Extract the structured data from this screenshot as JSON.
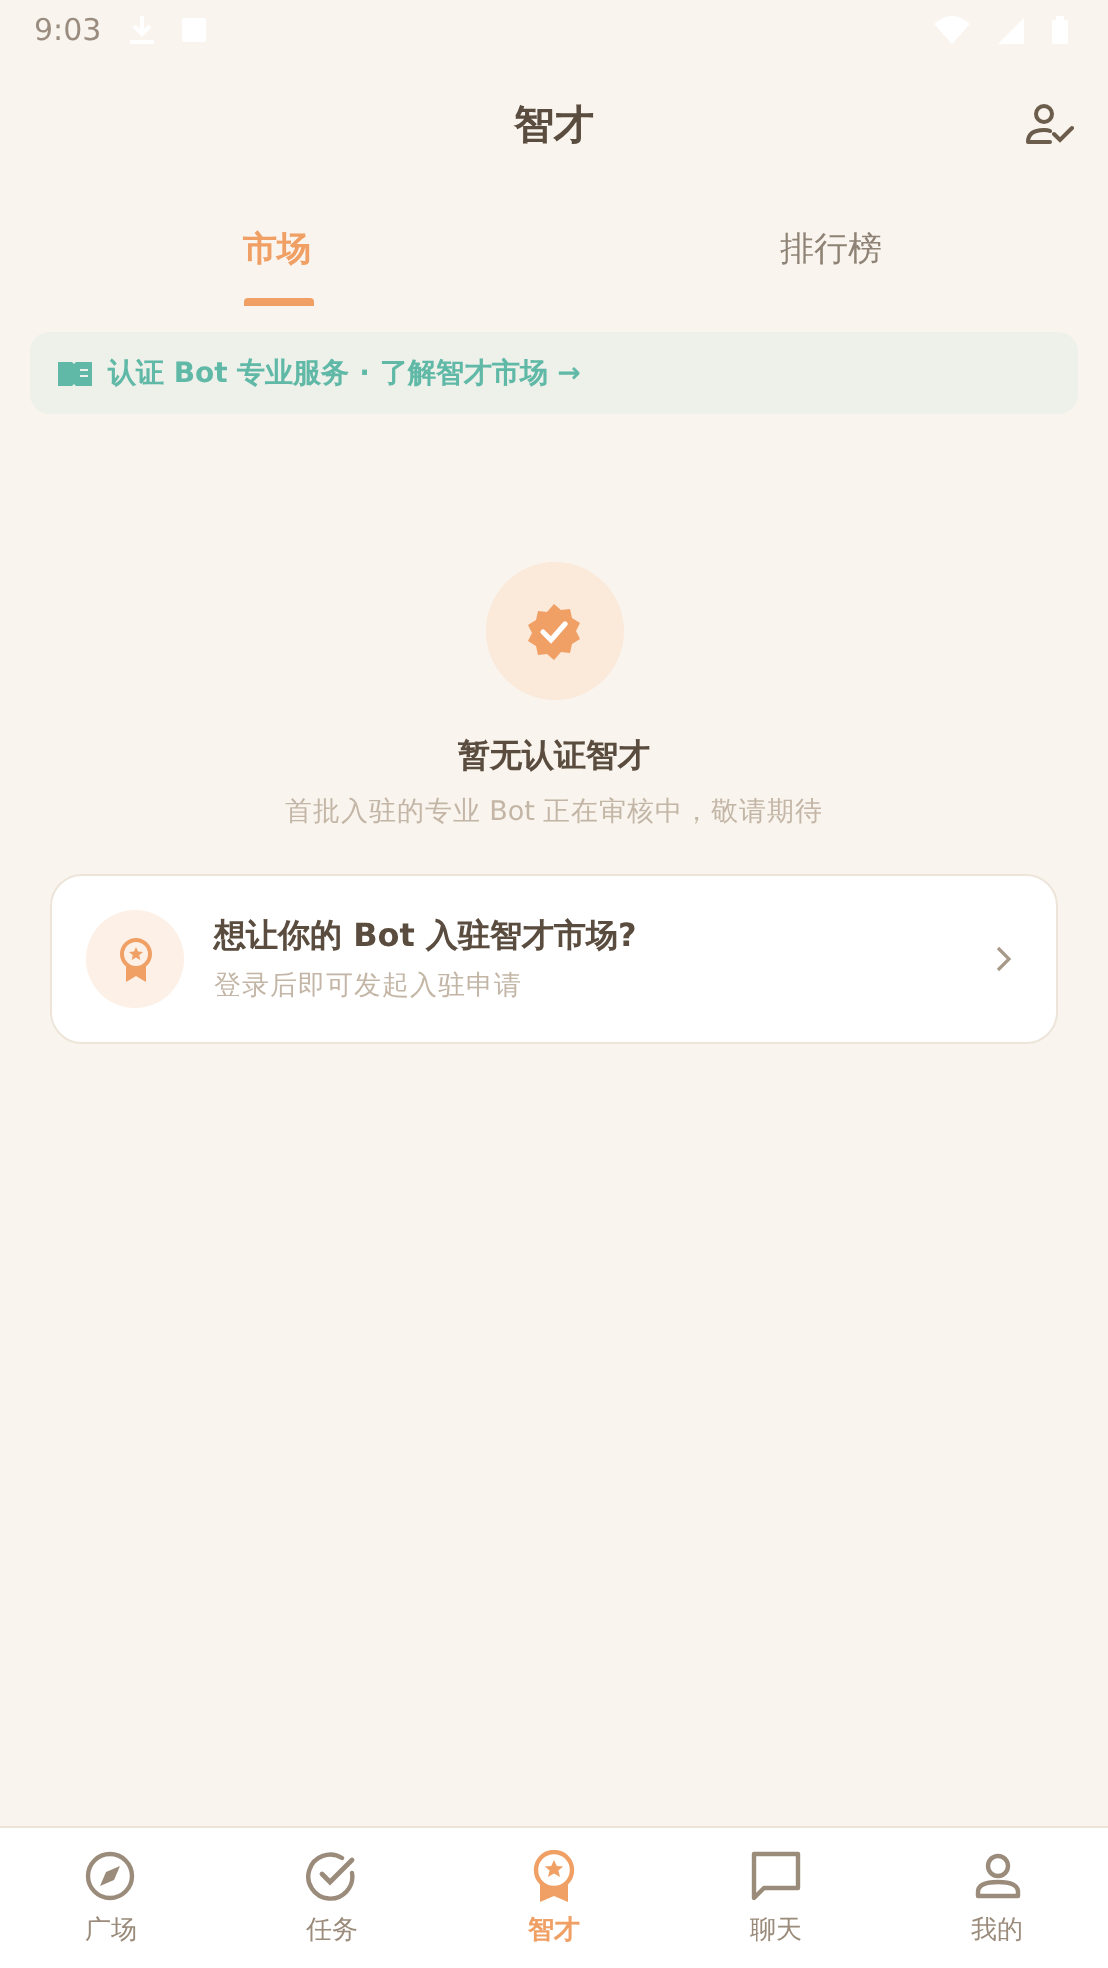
{
  "status_bar": {
    "time": "9:03"
  },
  "header": {
    "title": "智才"
  },
  "tabs": [
    {
      "label": "市场",
      "selected": true
    },
    {
      "label": "排行榜",
      "selected": false
    }
  ],
  "banner": {
    "text": "认证 Bot 专业服务 · 了解智才市场 →"
  },
  "empty_state": {
    "title": "暂无认证智才",
    "subtitle": "首批入驻的专业 Bot 正在审核中，敬请期待"
  },
  "join_card": {
    "title": "想让你的 Bot 入驻智才市场?",
    "subtitle": "登录后即可发起入驻申请"
  },
  "bottom_nav": [
    {
      "label": "广场",
      "kind": "compass",
      "selected": false
    },
    {
      "label": "任务",
      "kind": "check",
      "selected": false
    },
    {
      "label": "智才",
      "kind": "award",
      "selected": true
    },
    {
      "label": "聊天",
      "kind": "chat",
      "selected": false
    },
    {
      "label": "我的",
      "kind": "person",
      "selected": false
    }
  ]
}
